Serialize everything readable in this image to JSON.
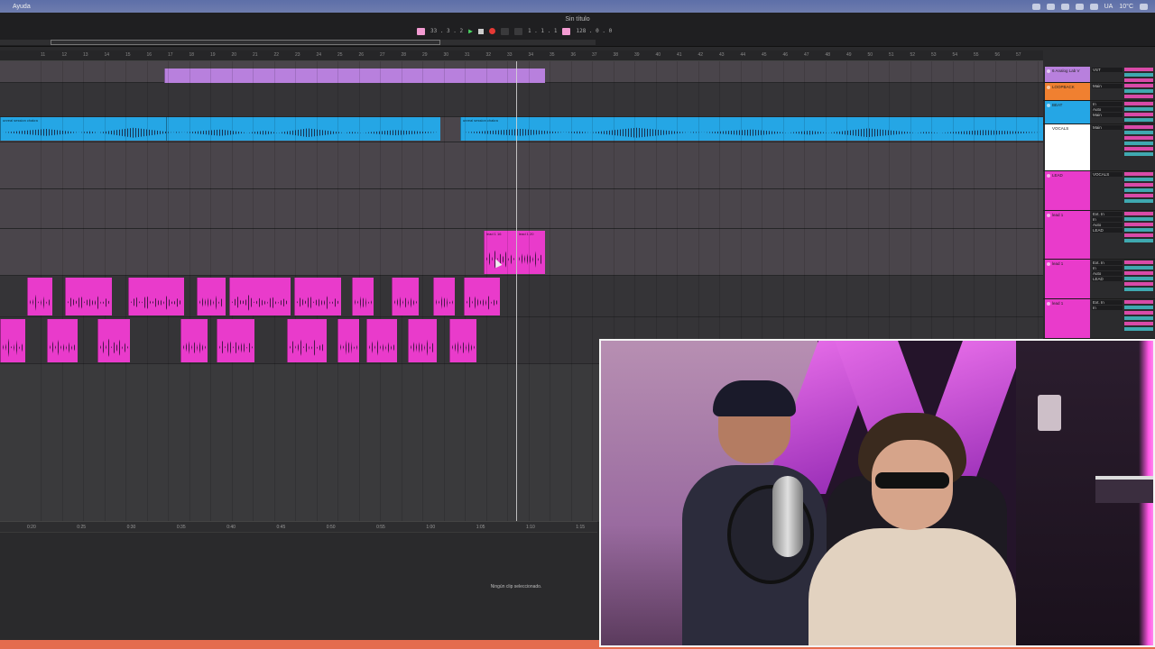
{
  "menubar": {
    "item": "Ayuda",
    "tray": {
      "a": "UA",
      "b": "10°C"
    }
  },
  "titlebar": {
    "title": "Sin título"
  },
  "transport": {
    "position": "33 . 3 . 2",
    "loop_start": "1 . 1 . 1",
    "tempo": "128 . 0 . 0"
  },
  "ruler_bars": [
    "11",
    "12",
    "13",
    "14",
    "15",
    "16",
    "17",
    "18",
    "19",
    "20",
    "21",
    "22",
    "23",
    "24",
    "25",
    "26",
    "27",
    "28",
    "29",
    "30",
    "31",
    "32",
    "33",
    "34",
    "35",
    "36",
    "37",
    "38",
    "39",
    "40",
    "41",
    "42",
    "43",
    "44",
    "45",
    "46",
    "47",
    "48",
    "49",
    "50",
    "51",
    "52",
    "53",
    "54",
    "55",
    "56",
    "57"
  ],
  "time_labels": [
    "0:20",
    "0:25",
    "0:30",
    "0:35",
    "0:40",
    "0:45",
    "0:50",
    "0:55",
    "1:00",
    "1:05",
    "1:10",
    "1:15"
  ],
  "clips": {
    "beat_label": "unreal session chakra",
    "beat_label_2": "unreal session chakra",
    "lead_a": "lead 1 16",
    "lead_b": "lead 1 20"
  },
  "mixer": {
    "tracks": [
      {
        "name": "6 Analog Lab V",
        "color": "#b880dd",
        "io": [
          "VST"
        ]
      },
      {
        "name": "LOOPBACK",
        "color": "#f08030",
        "io": [
          "Main"
        ]
      },
      {
        "name": "BEAT",
        "color": "#25a6e5",
        "io": [
          "In",
          "Auto",
          "Main"
        ]
      },
      {
        "name": "VOCALS",
        "color": "#ffffff",
        "io": [
          "Main"
        ]
      },
      {
        "name": "LEAD",
        "color": "#e93bcb",
        "io": [
          "VOCALS"
        ]
      },
      {
        "name": "lead 1",
        "color": "#e93bcb",
        "io": [
          "Ext. In",
          "In",
          "Auto",
          "LEAD"
        ]
      },
      {
        "name": "lead 1",
        "color": "#e93bcb",
        "io": [
          "Ext. In",
          "In",
          "Auto",
          "LEAD"
        ]
      },
      {
        "name": "lead 1",
        "color": "#e93bcb",
        "io": [
          "Ext. In",
          "In"
        ]
      }
    ]
  },
  "detail": {
    "no_clip": "Ningún clip seleccionado."
  },
  "colors": {
    "pink": "#e93bcb",
    "blue": "#25a6e5",
    "purple": "#b880dd",
    "accent_bar": "#e46c4e"
  }
}
